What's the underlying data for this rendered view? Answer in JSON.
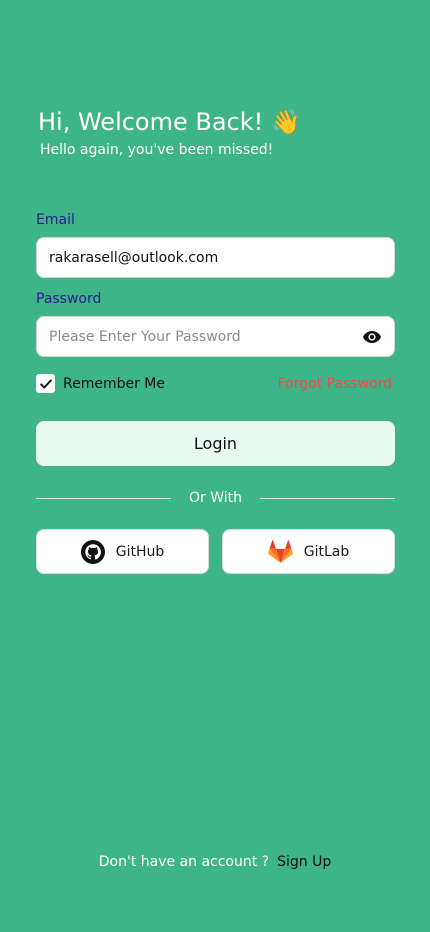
{
  "header": {
    "title": "Hi, Welcome Back!",
    "title_emoji": "👋",
    "subtitle": "Hello again, you've been missed!"
  },
  "form": {
    "email_label": "Email",
    "email_value": "rakarasell@outlook.com",
    "password_label": "Password",
    "password_placeholder": "Please Enter Your Password",
    "password_toggle_icon": "eye-icon",
    "remember_label": "Remember Me",
    "remember_checked": true,
    "forgot_label": "Forgot Password",
    "login_label": "Login"
  },
  "divider": {
    "label": "Or With"
  },
  "social": {
    "github_label": "GitHub",
    "github_icon": "github-icon",
    "gitlab_label": "GitLab",
    "gitlab_icon": "gitlab-icon"
  },
  "footer": {
    "question": "Don't have an account ?",
    "signup_label": "Sign Up"
  },
  "colors": {
    "background": "#3eb489",
    "label": "#2a1b8f",
    "forgot": "#ec4b4b",
    "login_button": "#e8fbf2"
  }
}
